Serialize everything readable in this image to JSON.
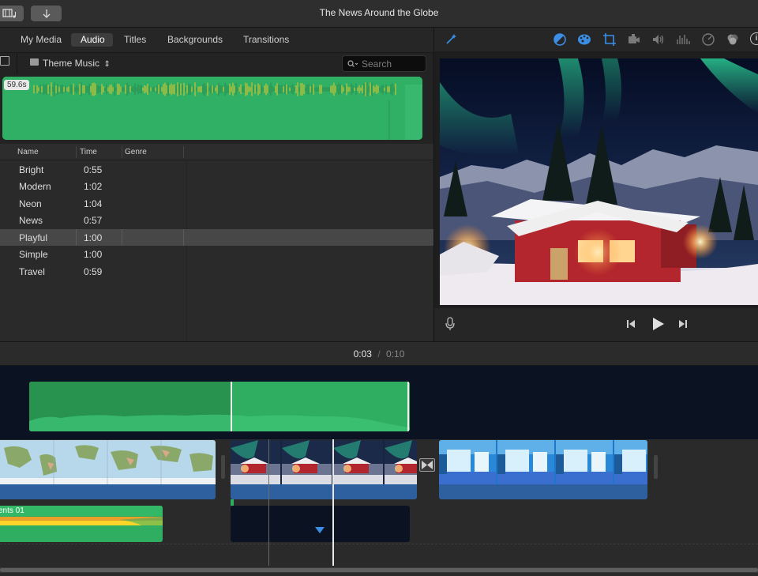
{
  "window": {
    "title": "The News Around the Globe"
  },
  "toolbar": {
    "media_icon": "film-music-icon",
    "import_icon": "import-arrow-icon"
  },
  "tabs": [
    {
      "label": "My Media"
    },
    {
      "label": "Audio"
    },
    {
      "label": "Titles"
    },
    {
      "label": "Backgrounds"
    },
    {
      "label": "Transitions"
    }
  ],
  "browser": {
    "source_label": "Theme Music",
    "search_placeholder": "Search",
    "preview_duration": "59.6s"
  },
  "list": {
    "columns": [
      "Name",
      "Time",
      "Genre"
    ],
    "rows": [
      {
        "name": "Bright",
        "time": "0:55"
      },
      {
        "name": "Modern",
        "time": "1:02"
      },
      {
        "name": "Neon",
        "time": "1:04"
      },
      {
        "name": "News",
        "time": "0:57"
      },
      {
        "name": "Playful",
        "time": "1:00"
      },
      {
        "name": "Simple",
        "time": "1:00"
      },
      {
        "name": "Travel",
        "time": "0:59"
      }
    ],
    "selected": "Playful"
  },
  "viewer": {
    "tools": [
      "magic-wand-icon",
      "color-balance-icon",
      "color-palette-icon",
      "crop-icon",
      "stabilization-icon",
      "volume-icon",
      "equalizer-icon",
      "speed-icon",
      "filter-icon",
      "info-icon"
    ]
  },
  "playback": {
    "current": "0:03",
    "separator": "/",
    "total": "0:10"
  },
  "timeline": {
    "title_clip_label": "ents 01"
  },
  "colors": {
    "audio_green": "#30b065",
    "accent_blue": "#3a8ee6",
    "selection": "#474747",
    "clip_blue": "#2e5f9e"
  }
}
